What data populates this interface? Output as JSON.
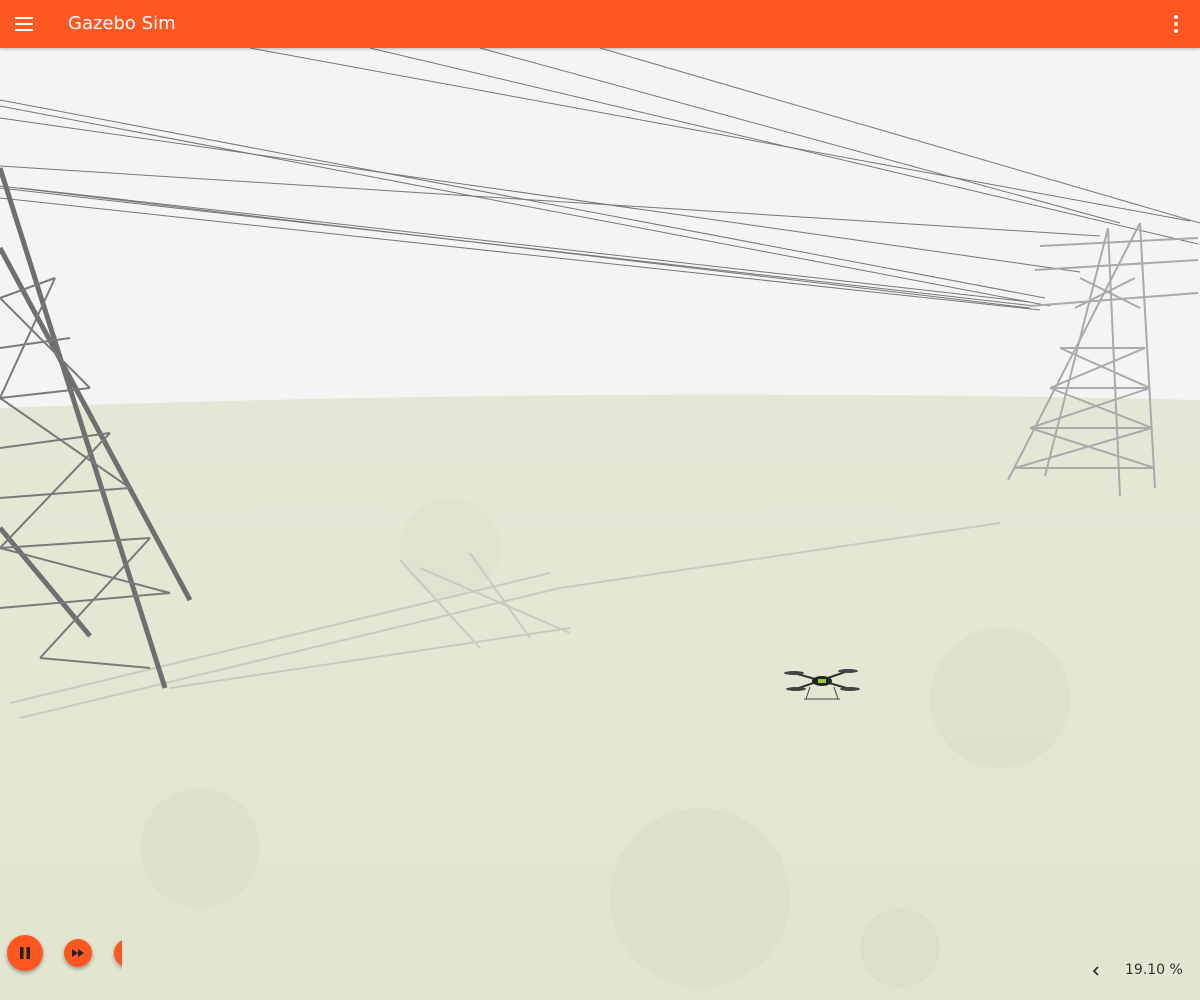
{
  "app": {
    "title": "Gazebo Sim"
  },
  "header": {
    "menu_icon": "hamburger-menu-icon",
    "options_icon": "more-vert-icon"
  },
  "colors": {
    "accent": "#ff5722",
    "sky": "#f4f4f4",
    "ground": "#e6e6d6"
  },
  "controls": {
    "play_pause_icon": "pause-icon",
    "step_icon": "fast-forward-icon"
  },
  "stats": {
    "collapse_icon": "chevron-left-icon",
    "real_time_factor": "19.10 %"
  }
}
